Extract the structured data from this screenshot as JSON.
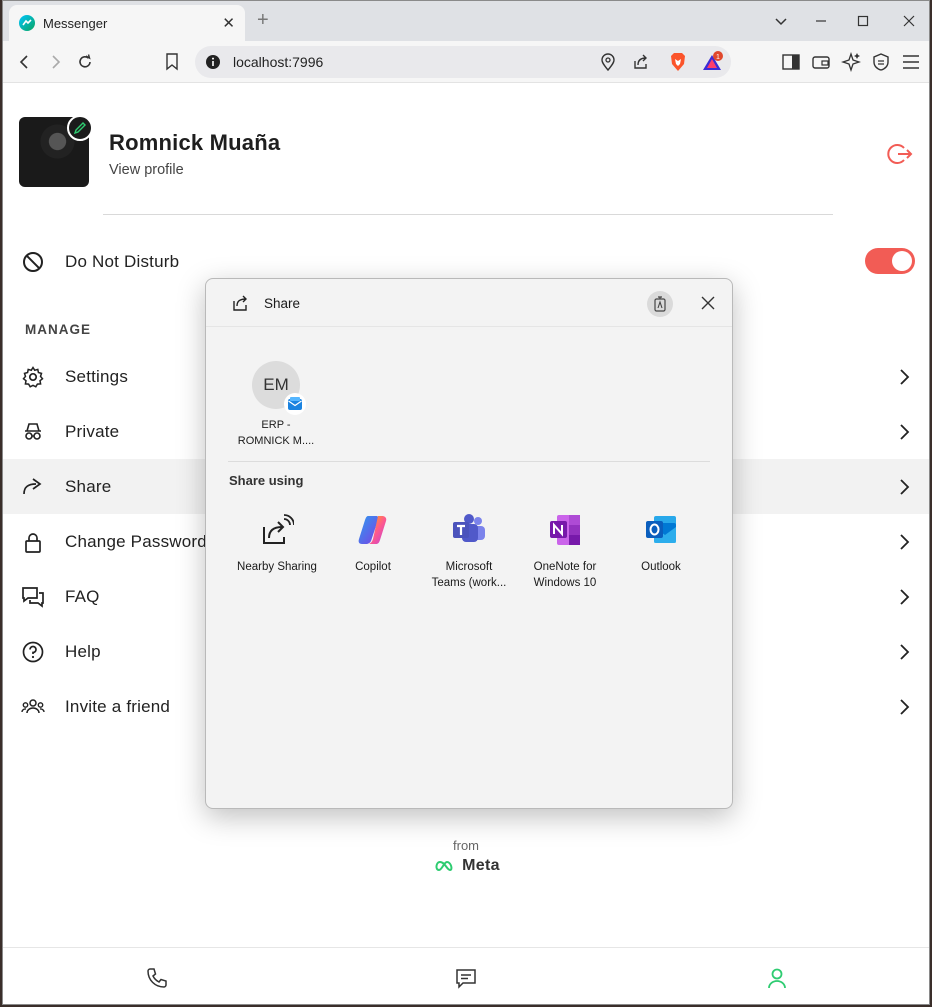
{
  "browser": {
    "tab_title": "Messenger",
    "url": "localhost:7996",
    "notification_count": "1"
  },
  "profile": {
    "name": "Romnick Muaña",
    "view_profile": "View profile"
  },
  "dnd": {
    "label": "Do Not Disturb",
    "enabled": true
  },
  "manage": {
    "title": "MANAGE",
    "items": [
      {
        "label": "Settings",
        "icon": "gear-icon"
      },
      {
        "label": "Private",
        "icon": "incognito-icon"
      },
      {
        "label": "Share",
        "icon": "share-arrow-icon"
      },
      {
        "label": "Change Password",
        "icon": "lock-icon"
      },
      {
        "label": "FAQ",
        "icon": "chat-bubbles-icon"
      },
      {
        "label": "Help",
        "icon": "question-circle-icon"
      },
      {
        "label": "Invite a friend",
        "icon": "group-icon"
      }
    ]
  },
  "footer": {
    "from": "from",
    "brand": "Meta"
  },
  "bottom_nav": [
    "phone-icon",
    "chat-icon",
    "user-icon"
  ],
  "share_dialog": {
    "title": "Share",
    "contact": {
      "initials": "EM",
      "name_line1": "ERP -",
      "name_line2": "ROMNICK M...."
    },
    "share_using": "Share using",
    "apps": [
      {
        "line1": "Nearby Sharing",
        "line2": ""
      },
      {
        "line1": "Copilot",
        "line2": ""
      },
      {
        "line1": "Microsoft",
        "line2": "Teams (work..."
      },
      {
        "line1": "OneNote for",
        "line2": "Windows 10"
      },
      {
        "line1": "Outlook",
        "line2": ""
      }
    ]
  },
  "colors": {
    "accent_red": "#f25c55",
    "accent_green": "#2ecc71"
  }
}
